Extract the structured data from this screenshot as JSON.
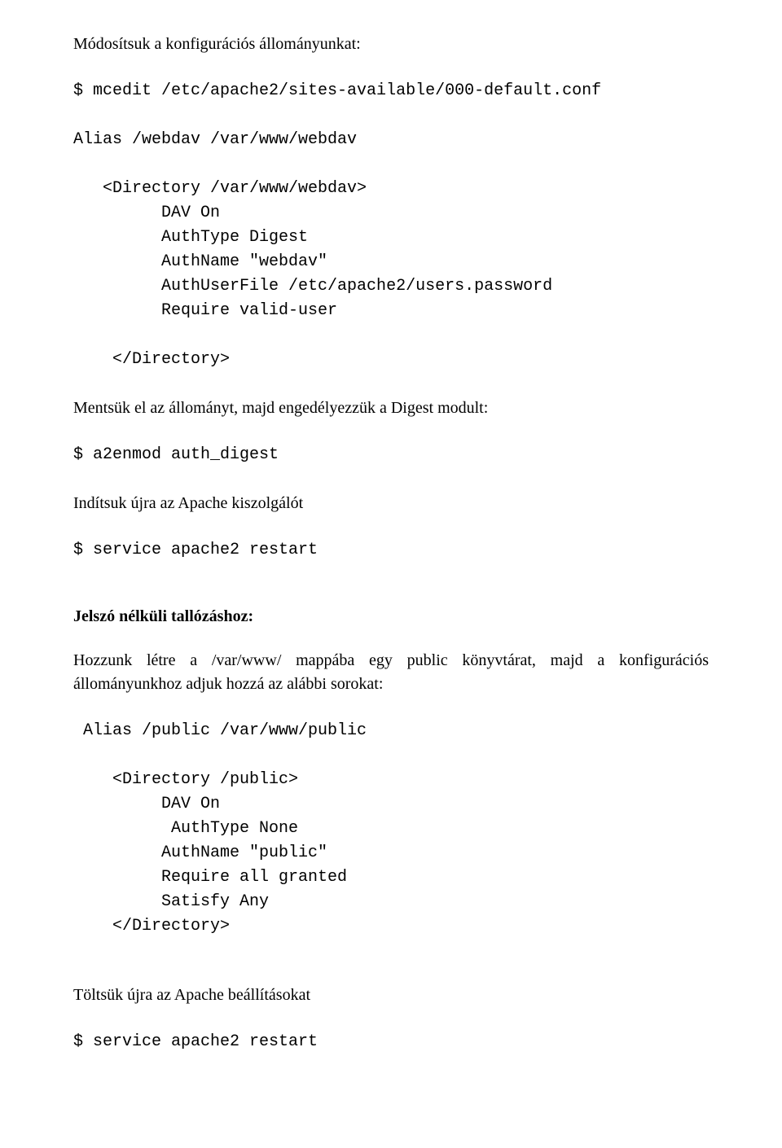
{
  "p1": "Módosítsuk a konfigurációs állományunkat:",
  "cmd1": "$ mcedit /etc/apache2/sites-available/000-default.conf",
  "conf1_l1": "Alias /webdav /var/www/webdav",
  "conf1_l2": "   <Directory /var/www/webdav>",
  "conf1_l3": "         DAV On",
  "conf1_l4": "         AuthType Digest",
  "conf1_l5": "         AuthName \"webdav\"",
  "conf1_l6": "         AuthUserFile /etc/apache2/users.password",
  "conf1_l7": "         Require valid-user",
  "conf1_l8": "    </Directory>",
  "p2": "Mentsük el az állományt, majd engedélyezzük a Digest modult:",
  "cmd2": "$ a2enmod auth_digest",
  "p3": "Indítsuk újra az Apache kiszolgálót",
  "cmd3": "$ service apache2 restart",
  "h1": "Jelszó nélküli tallózáshoz:",
  "p4": "Hozzunk létre a /var/www/ mappába egy public könyvtárat, majd a konfigurációs állományunkhoz adjuk hozzá az alábbi sorokat:",
  "conf2_l1": " Alias /public /var/www/public",
  "conf2_l2": "    <Directory /public>",
  "conf2_l3": "         DAV On",
  "conf2_l4": "          AuthType None",
  "conf2_l5": "         AuthName \"public\"",
  "conf2_l6": "         Require all granted",
  "conf2_l7": "         Satisfy Any",
  "conf2_l8": "    </Directory>",
  "p5": "Töltsük újra az Apache beállításokat",
  "cmd4": "$ service apache2 restart"
}
